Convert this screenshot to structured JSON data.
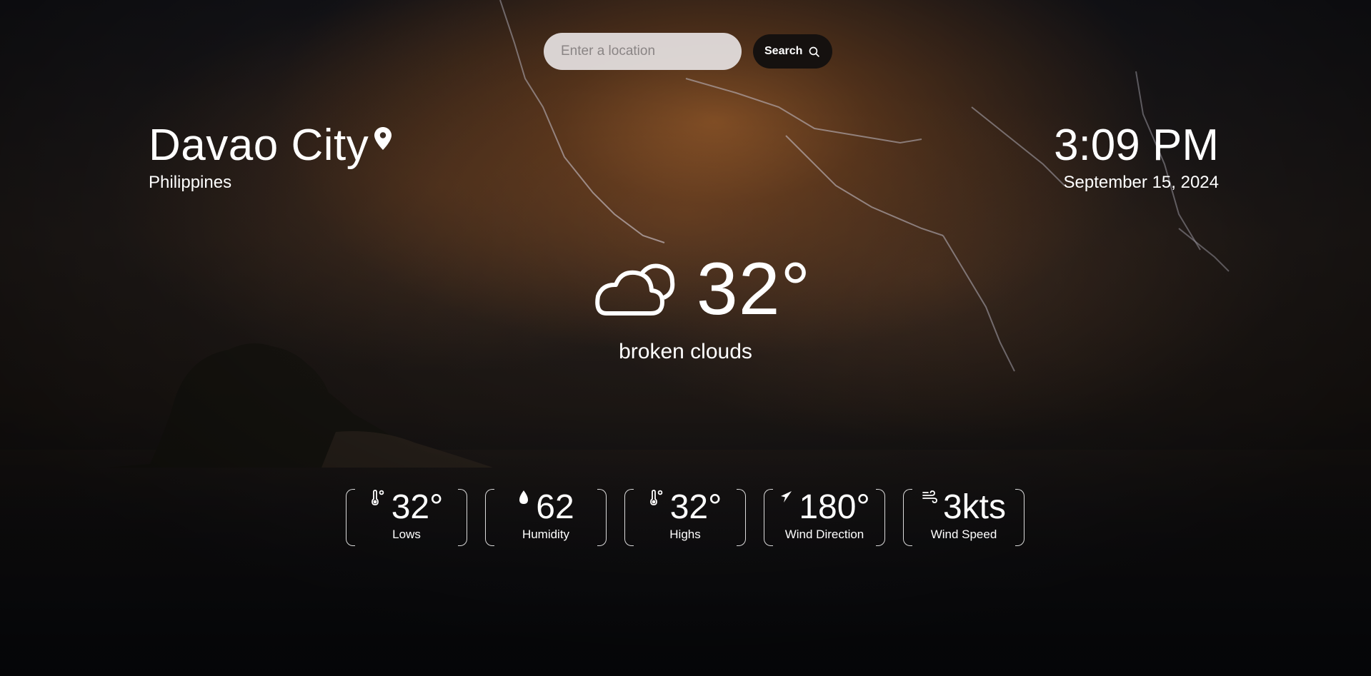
{
  "search": {
    "placeholder": "Enter a location",
    "value": "",
    "button_label": "Search"
  },
  "location": {
    "city": "Davao City",
    "country": "Philippines"
  },
  "clock": {
    "time": "3:09 PM",
    "date": "September 15, 2024"
  },
  "current": {
    "temperature": "32°",
    "description": "broken clouds",
    "icon": "broken-clouds-icon"
  },
  "stats": [
    {
      "value": "32°",
      "label": "Lows",
      "icon": "thermometer-icon"
    },
    {
      "value": "62",
      "label": "Humidity",
      "icon": "droplet-icon"
    },
    {
      "value": "32°",
      "label": "Highs",
      "icon": "thermometer-icon"
    },
    {
      "value": "180°",
      "label": "Wind Direction",
      "icon": "navigation-arrow-icon"
    },
    {
      "value": "3kts",
      "label": "Wind Speed",
      "icon": "wind-icon"
    }
  ]
}
